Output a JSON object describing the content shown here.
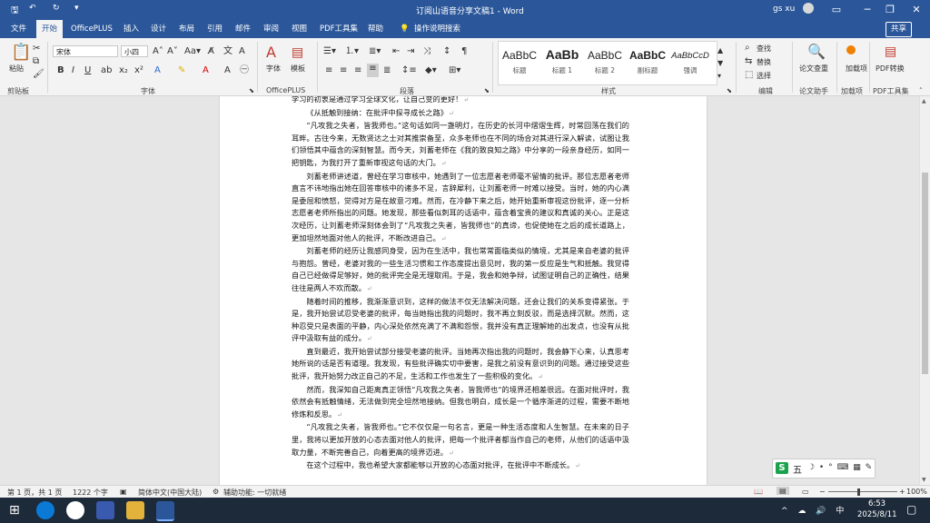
{
  "titlebar": {
    "save_icon": "save-icon",
    "title": "订阅山语音分享文稿1 - Word",
    "user": "gs xu",
    "minimize": "─",
    "restore": "❐",
    "close": "✕",
    "ribbon_display": "▭"
  },
  "tabs": [
    "文件",
    "开始",
    "OfficePLUS",
    "插入",
    "设计",
    "布局",
    "引用",
    "邮件",
    "审阅",
    "视图",
    "PDF工具集",
    "帮助"
  ],
  "active_tab": "开始",
  "tell_me": "操作说明搜索",
  "share": "共享",
  "ribbon": {
    "clipboard": {
      "paste": "粘贴",
      "group": "剪贴板"
    },
    "font": {
      "name": "宋体",
      "size": "小四",
      "group": "字体"
    },
    "paragraph": {
      "group": "段落"
    },
    "officeplus": {
      "font_btn": "字体",
      "template_btn": "模板",
      "group": "OfficePLUS"
    },
    "styles": {
      "group": "样式",
      "items": [
        {
          "sample": "AaBbC",
          "name": "标题"
        },
        {
          "sample": "AaBb",
          "name": "标题 1"
        },
        {
          "sample": "AaBbC",
          "name": "标题 2"
        },
        {
          "sample": "AaBbC",
          "name": "副标题"
        },
        {
          "sample": "AaBbCcD",
          "name": "强调"
        }
      ]
    },
    "editing": {
      "find": "查找",
      "replace": "替换",
      "select": "选择",
      "group": "编辑"
    },
    "paper_check": {
      "label": "论文查重",
      "group": "论文助手"
    },
    "addins": {
      "label": "加载项",
      "group": "加载项"
    },
    "pdf": {
      "label": "PDF转换",
      "group": "PDF工具集"
    }
  },
  "document": {
    "paragraphs": [
      "学习的初衷是通过学习全球文化，让自己变的更好！",
      "《从抵触到接纳：在批评中探寻成长之路》",
      "“凡攻我之失者，皆我师也。”这句话如同一盏明灯，在历史的长河中熠熠生辉，时常回荡在我们的耳畔。古往今来，无数贤达之士对其推崇备至，众多老师也在不同的场合对其进行深入解读，试图让我们领悟其中蕴含的深刻智慧。而今天，刘蓄老师在《我的致良知之路》中分享的一段亲身经历，如同一把钥匙，为我打开了重新审视这句话的大门。",
      "刘蓄老师讲述道，曾经在学习审核中，她遇到了一位志愿者老师毫不留情的批评。那位志愿者老师直言不讳地指出她在回答审核中的诸多不足，言辞犀利，让刘蓄老师一时难以接受。当时，她的内心满是委屈和愤怒，觉得对方是在故意刁难。然而，在冷静下来之后，她开始重新审视这份批评，逐一分析志愿者老师所指出的问题。她发现，那些看似刺耳的话语中，蕴含着宝贵的建议和真诚的关心。正是这次经历，让刘蓄老师深刻体会到了“凡攻我之失者，皆我师也”的真谛，也促使她在之后的成长道路上，更加坦然地面对他人的批评，不断改进自己。",
      "刘蓄老师的经历让我感同身受，因为在生活中，我也常常面临类似的情境，尤其是来自老婆的批评与抱怨。曾经，老婆对我的一些生活习惯和工作态度提出意见时，我的第一反应是生气和抵触。我觉得自己已经做得足够好，她的批评完全是无理取闹。于是，我会和她争辩，试图证明自己的正确性，结果往往是两人不欢而散。",
      "随着时间的推移，我渐渐意识到，这样的做法不仅无法解决问题，还会让我们的关系变得紧张。于是，我开始尝试忍受老婆的批评，每当她指出我的问题时，我不再立刻反驳，而是选择沉默。然而，这种忍受只是表面的平静，内心深处依然充满了不满和怨恨，我并没有真正理解她的出发点，也没有从批评中汲取有益的成分。",
      "直到最近，我开始尝试部分接受老婆的批评。当她再次指出我的问题时，我会静下心来，认真思考她所说的话是否有道理。我发现，有些批评确实切中要害，是我之前没有意识到的问题。通过接受这些批评，我开始努力改正自己的不足，生活和工作也发生了一些积极的变化。",
      "然而，我深知自己距离真正领悟“凡攻我之失者，皆我师也”的境界还相差很远。在面对批评时，我依然会有抵触情绪，无法做到完全坦然地接纳。但我也明白，成长是一个循序渐进的过程，需要不断地修炼和反思。",
      "“凡攻我之失者，皆我师也。”它不仅仅是一句名言，更是一种生活态度和人生智慧。在未来的日子里，我将以更加开放的心态去面对他人的批评，把每一个批评者都当作自己的老师，从他们的话语中汲取力量，不断完善自己，向着更高的境界迈进。",
      "在这个过程中，我也希望大家都能够以开放的心态面对批评，在批评中不断成长。"
    ]
  },
  "status": {
    "page": "第 1 页，共 1 页",
    "words": "1222 个字",
    "language": "简体中文(中国大陆)",
    "accessibility": "辅助功能: 一切就绪",
    "zoom": "100%"
  },
  "ime": {
    "label": "五",
    "icons": "☽ • ° ⌨ ▦ ✎"
  },
  "taskbar": {
    "time": "6:53",
    "date": "2025/8/11",
    "tray": "^ ☁ 🔊 中"
  }
}
